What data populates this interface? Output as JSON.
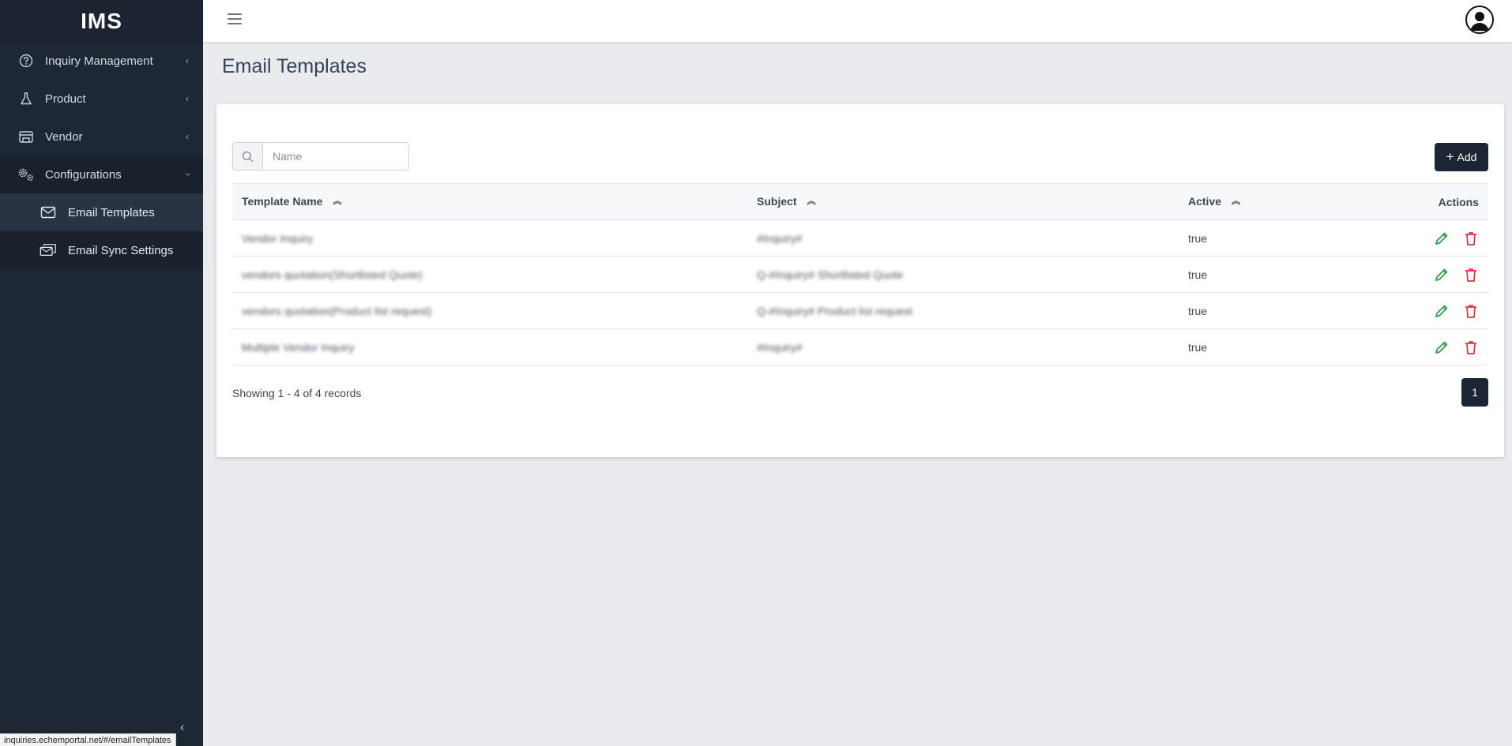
{
  "app": {
    "brand": "IMS"
  },
  "sidebar": {
    "items": [
      {
        "label": "Inquiry Management",
        "icon": "question-circle-icon"
      },
      {
        "label": "Product",
        "icon": "flask-icon"
      },
      {
        "label": "Vendor",
        "icon": "store-icon"
      },
      {
        "label": "Configurations",
        "icon": "gears-icon"
      }
    ],
    "subitems": [
      {
        "label": "Email Templates",
        "icon": "envelope-icon"
      },
      {
        "label": "Email Sync Settings",
        "icon": "email-sync-icon"
      }
    ],
    "status_url": "inquiries.echemportal.net/#/emailTemplates"
  },
  "page": {
    "title": "Email Templates"
  },
  "toolbar": {
    "search_placeholder": "Name",
    "add_label": "Add"
  },
  "table": {
    "headers": {
      "name": "Template Name",
      "subject": "Subject",
      "active": "Active",
      "actions": "Actions"
    },
    "rows": [
      {
        "name": "Vendor Inquiry",
        "subject": "#Inquiry#",
        "active": "true"
      },
      {
        "name": "vendors quotation(Shortlisted Quote)",
        "subject": "Q-#Inquiry# Shortlisted Quote",
        "active": "true"
      },
      {
        "name": "vendors quotation(Product list request)",
        "subject": "Q-#Inquiry# Product list request",
        "active": "true"
      },
      {
        "name": "Multiple Vendor Inquiry",
        "subject": "#Inquiry#",
        "active": "true"
      }
    ]
  },
  "footer": {
    "records": "Showing 1 - 4 of 4 records",
    "page": "1"
  },
  "colors": {
    "sidebar": "#1e2734",
    "accent": "#1c2533",
    "edit": "#2e9e49",
    "delete": "#d9363e"
  }
}
